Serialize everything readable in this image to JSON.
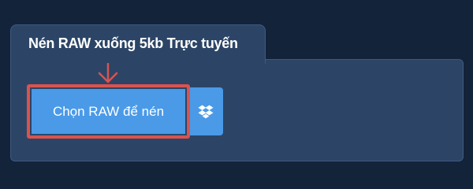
{
  "header": {
    "title": "Nén RAW xuống 5kb Trực tuyến"
  },
  "upload": {
    "choose_label": "Chọn RAW để nén",
    "dropbox_icon": "dropbox-icon",
    "pointer_icon": "arrow-down-icon"
  },
  "colors": {
    "page_background": "#13233a",
    "panel_background": "#2c4566",
    "button_blue": "#4a9ae8",
    "highlight_red": "#d9534f"
  }
}
